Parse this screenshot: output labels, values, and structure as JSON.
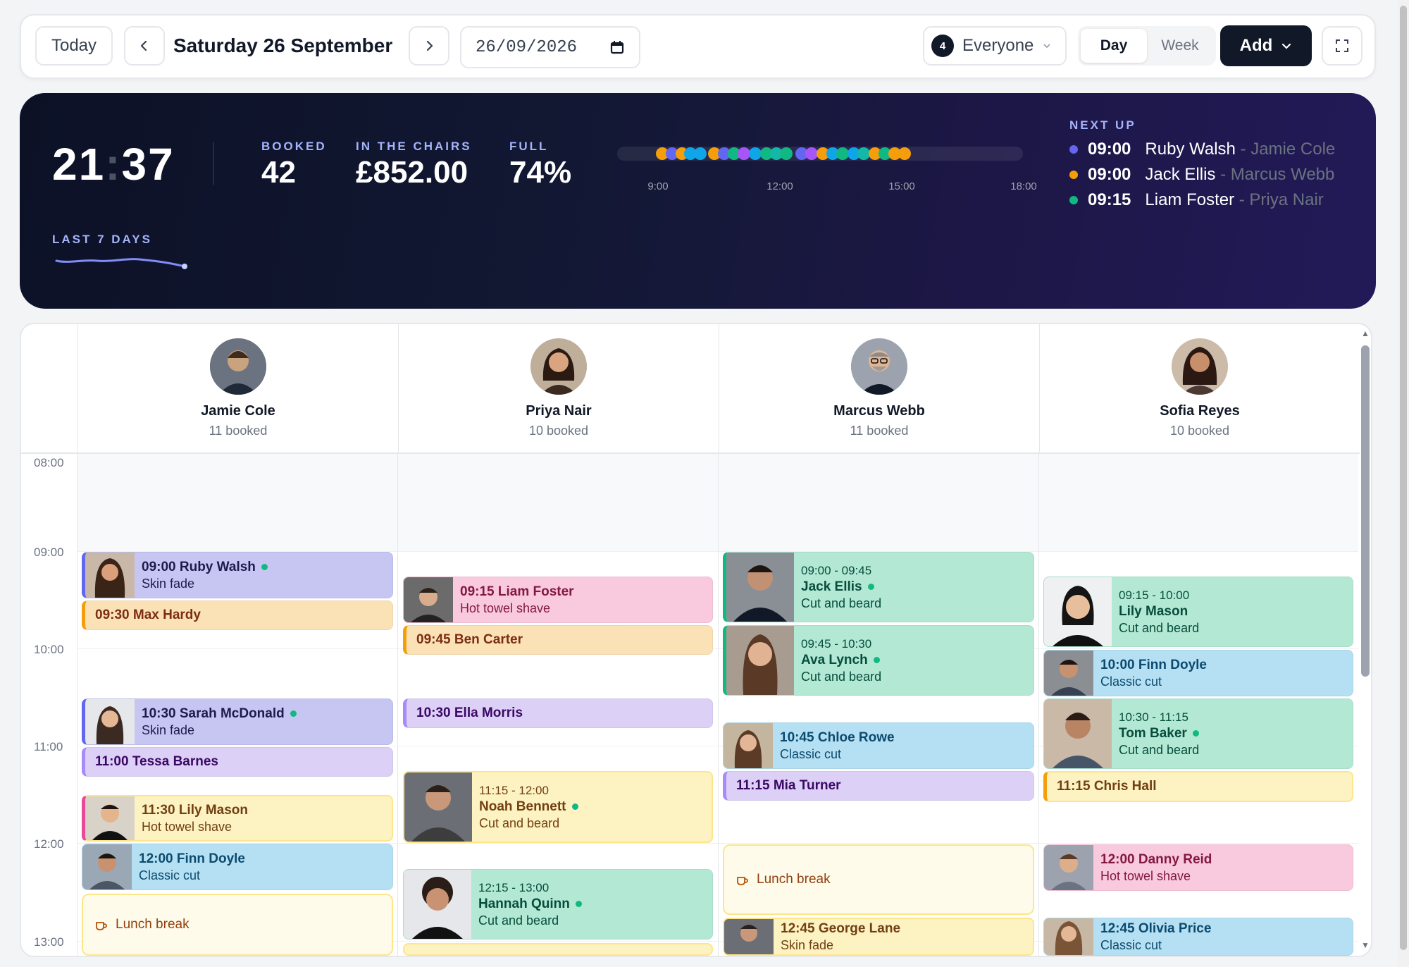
{
  "toolbar": {
    "today_label": "Today",
    "date_title": "Saturday 26 September",
    "date_input_value": "26/09/2026",
    "everyone_count": "4",
    "everyone_label": "Everyone",
    "view_day": "Day",
    "view_week": "Week",
    "add_label": "Add"
  },
  "hero": {
    "clock_hours": "21",
    "clock_minutes": "37",
    "booked_label": "BOOKED",
    "booked_value": "42",
    "chairs_label": "IN THE CHAIRS",
    "chairs_value": "£852.00",
    "full_label": "FULL",
    "full_value": "74%",
    "timeline_ticks": [
      "9:00",
      "12:00",
      "15:00",
      "18:00"
    ],
    "next_up_label": "NEXT UP",
    "next_up": [
      {
        "time": "09:00",
        "client": "Ruby Walsh",
        "staff": "Jamie Cole",
        "color": "#6366f1"
      },
      {
        "time": "09:00",
        "client": "Jack Ellis",
        "staff": "Marcus Webb",
        "color": "#f59e0b"
      },
      {
        "time": "09:15",
        "client": "Liam Foster",
        "staff": "Priya Nair",
        "color": "#10b981"
      }
    ],
    "last7_label": "LAST 7 DAYS"
  },
  "staff": [
    {
      "name": "Jamie Cole",
      "booked": "11 booked"
    },
    {
      "name": "Priya Nair",
      "booked": "10 booked"
    },
    {
      "name": "Marcus Webb",
      "booked": "11 booked"
    },
    {
      "name": "Sofia Reyes",
      "booked": "10 booked"
    }
  ],
  "hours": [
    "08:00",
    "09:00",
    "10:00",
    "11:00",
    "12:00",
    "13:00"
  ],
  "appointments": {
    "jamie": [
      {
        "title": "09:00 Ruby Walsh",
        "service": "Skin fade"
      },
      {
        "title": "09:30 Max Hardy"
      },
      {
        "title": "10:30 Sarah McDonald",
        "service": "Skin fade"
      },
      {
        "title": "11:00 Tessa Barnes"
      },
      {
        "title": "11:30 Lily Mason",
        "service": "Hot towel shave"
      },
      {
        "title": "12:00 Finn Doyle",
        "service": "Classic cut"
      },
      {
        "break": "Lunch break"
      }
    ],
    "priya": [
      {
        "title": "09:15 Liam Foster",
        "service": "Hot towel shave"
      },
      {
        "title": "09:45 Ben Carter"
      },
      {
        "title": "10:30 Ella Morris"
      },
      {
        "range": "11:15 - 12:00",
        "title": "Noah Bennett",
        "service": "Cut and beard"
      },
      {
        "range": "12:15 - 13:00",
        "title": "Hannah Quinn",
        "service": "Cut and beard"
      }
    ],
    "marcus": [
      {
        "range": "09:00 - 09:45",
        "title": "Jack Ellis",
        "service": "Cut and beard"
      },
      {
        "range": "09:45 - 10:30",
        "title": "Ava Lynch",
        "service": "Cut and beard"
      },
      {
        "title": "10:45 Chloe Rowe",
        "service": "Classic cut"
      },
      {
        "title": "11:15 Mia Turner"
      },
      {
        "break": "Lunch break"
      },
      {
        "title": "12:45 George Lane",
        "service": "Skin fade"
      }
    ],
    "sofia": [
      {
        "range": "09:15 - 10:00",
        "title": "Lily Mason",
        "service": "Cut and beard"
      },
      {
        "title": "10:00 Finn Doyle",
        "service": "Classic cut"
      },
      {
        "range": "10:30 - 11:15",
        "title": "Tom Baker",
        "service": "Cut and beard"
      },
      {
        "title": "11:15 Chris Hall"
      },
      {
        "title": "12:00 Danny Reid",
        "service": "Hot towel shave"
      },
      {
        "title": "12:45 Olivia Price",
        "service": "Classic cut"
      }
    ]
  },
  "icons": {
    "prev": "chevron-left-icon",
    "next": "chevron-right-icon",
    "calendar": "calendar-icon",
    "dropdown": "chevron-down-icon",
    "expand": "expand-icon",
    "coffee": "coffee-icon"
  }
}
